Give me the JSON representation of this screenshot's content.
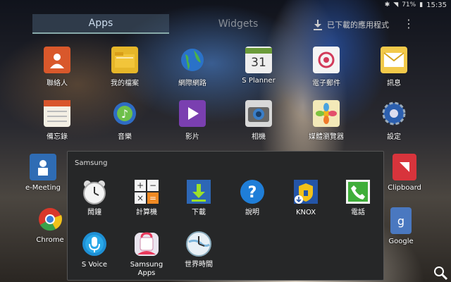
{
  "status": {
    "battery": "71%",
    "time": "15:35"
  },
  "tabs": {
    "apps": "Apps",
    "widgets": "Widgets"
  },
  "downloaded_label": "已下載的應用程式",
  "home_apps": [
    "聯絡人",
    "我的檔案",
    "網際網路",
    "S Planner",
    "電子郵件",
    "訊息",
    "備忘錄",
    "音樂",
    "影片",
    "相機",
    "媒體瀏覽器",
    "設定",
    "e-Meeting",
    "Chrome",
    "Clipboard",
    "Google"
  ],
  "calendar_day": "31",
  "folder": {
    "title": "Samsung",
    "apps": [
      "鬧鐘",
      "計算機",
      "下載",
      "說明",
      "KNOX",
      "電話",
      "S Voice",
      "Samsung Apps",
      "世界時間"
    ]
  },
  "icons": {
    "more": "more-vertical-icon",
    "download": "download-icon"
  }
}
